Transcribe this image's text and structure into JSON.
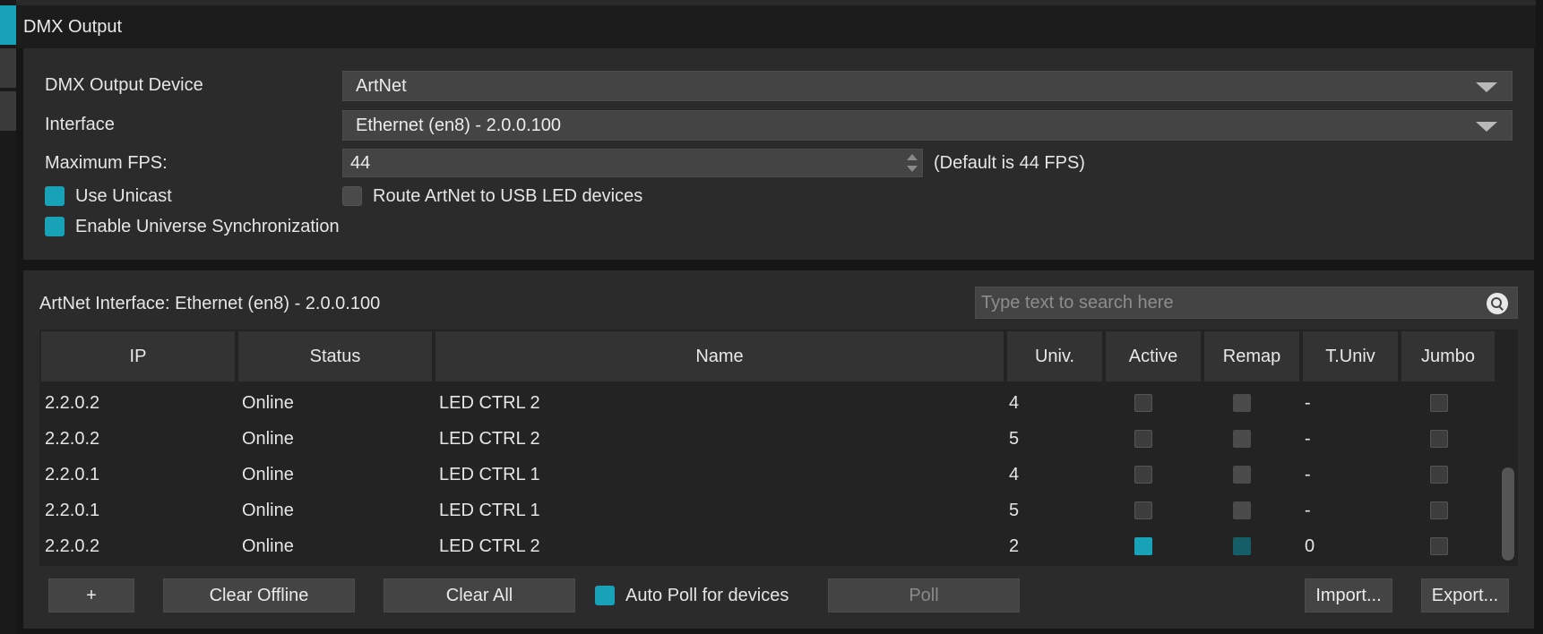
{
  "section": {
    "title": "DMX Output"
  },
  "settings": {
    "device_label": "DMX Output Device",
    "device_value": "ArtNet",
    "interface_label": "Interface",
    "interface_value": "Ethernet (en8) - 2.0.0.100",
    "fps_label": "Maximum FPS:",
    "fps_value": "44",
    "fps_hint": "(Default is 44 FPS)",
    "use_unicast_label": "Use Unicast",
    "use_unicast_checked": true,
    "route_label": "Route ArtNet to USB LED devices",
    "route_checked": false,
    "sync_label": "Enable Universe Synchronization",
    "sync_checked": true
  },
  "artnet": {
    "title": "ArtNet Interface: Ethernet (en8) - 2.0.0.100",
    "search_placeholder": "Type text to search here",
    "columns": [
      "IP",
      "Status",
      "Name",
      "Univ.",
      "Active",
      "Remap",
      "T.Univ",
      "Jumbo"
    ],
    "rows": [
      {
        "ip": "2.2.0.2",
        "status": "Online",
        "name": "LED CTRL 2",
        "univ": "4",
        "active": false,
        "remap": false,
        "tuniv": "-",
        "jumbo": false
      },
      {
        "ip": "2.2.0.2",
        "status": "Online",
        "name": "LED CTRL 2",
        "univ": "5",
        "active": false,
        "remap": false,
        "tuniv": "-",
        "jumbo": false
      },
      {
        "ip": "2.2.0.1",
        "status": "Online",
        "name": "LED CTRL 1",
        "univ": "4",
        "active": false,
        "remap": false,
        "tuniv": "-",
        "jumbo": false
      },
      {
        "ip": "2.2.0.1",
        "status": "Online",
        "name": "LED CTRL 1",
        "univ": "5",
        "active": false,
        "remap": false,
        "tuniv": "-",
        "jumbo": false
      },
      {
        "ip": "2.2.0.2",
        "status": "Online",
        "name": "LED CTRL 2",
        "univ": "2",
        "active": true,
        "remap": true,
        "tuniv": "0",
        "jumbo": false
      }
    ]
  },
  "buttons": {
    "add": "+",
    "clear_offline": "Clear Offline",
    "clear_all": "Clear All",
    "auto_poll_label": "Auto Poll for devices",
    "auto_poll_checked": true,
    "poll": "Poll",
    "import": "Import...",
    "export": "Export..."
  },
  "colors": {
    "accent": "#17a2b8",
    "remap_on": "#155e68",
    "panel_bg": "#2b2b2b",
    "field_bg": "#444444"
  }
}
